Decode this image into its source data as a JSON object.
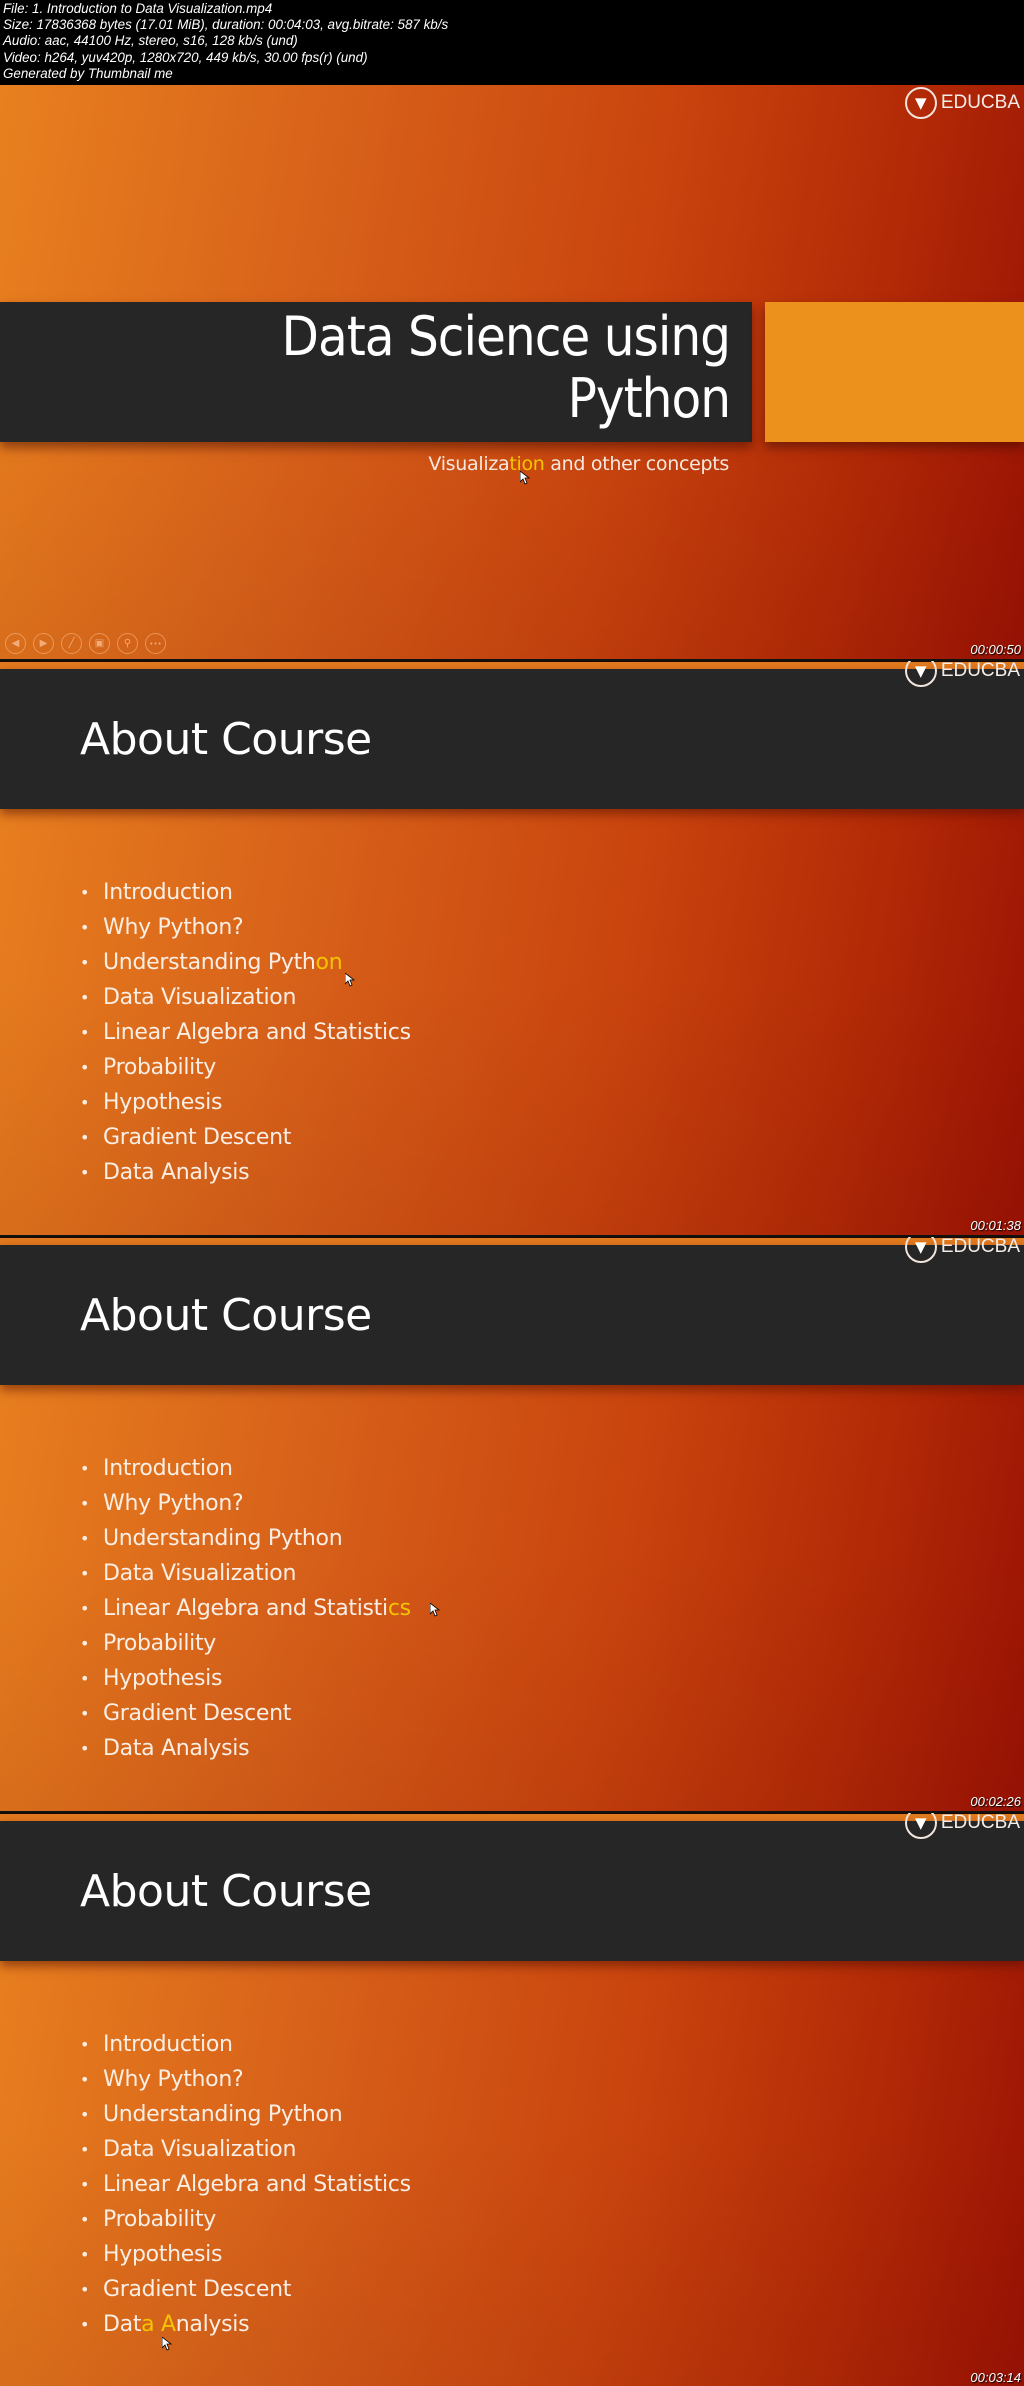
{
  "file_info": {
    "lines": [
      "File: 1. Introduction to Data Visualization.mp4",
      "Size: 17836368 bytes (17.01 MiB), duration: 00:04:03, avg.bitrate: 587 kb/s",
      "Audio: aac, 44100 Hz, stereo, s16, 128 kb/s (und)",
      "Video: h264, yuv420p, 1280x720, 449 kb/s, 30.00 fps(r) (und)",
      "Generated by Thumbnail me"
    ]
  },
  "brand": {
    "logo_text": "EDUCBA",
    "icon": "educba-book-cap-icon"
  },
  "colors": {
    "background_gradient_start": "#e8801f",
    "background_gradient_end": "#9a1204",
    "dark_band": "#262626",
    "accent_box": "#ec921c",
    "highlight": "#f3c400"
  },
  "slides": [
    {
      "type": "title",
      "title_line1": "Data Science using",
      "title_line2": "Python",
      "subtitle_pre": "Visualiza",
      "subtitle_hl": "tion",
      "subtitle_post": " and other concepts",
      "controls": [
        {
          "icon": "previous-icon",
          "glyph": "◀"
        },
        {
          "icon": "next-icon",
          "glyph": "▶"
        },
        {
          "icon": "pen-icon",
          "glyph": "╱"
        },
        {
          "icon": "slides-grid-icon",
          "glyph": "▣"
        },
        {
          "icon": "zoom-icon",
          "glyph": "⚲"
        },
        {
          "icon": "more-icon",
          "glyph": "•••"
        }
      ],
      "timestamp": "00:00:50"
    },
    {
      "type": "content",
      "title": "About Course",
      "items": [
        "Introduction",
        "Why Python?",
        "Understanding Pyth",
        "Data Visualization",
        "Linear Algebra and Statistics",
        "Probability",
        "Hypothesis",
        "Gradient Descent",
        "Data Analysis"
      ],
      "highlight_item": 2,
      "highlight_suffix": "on",
      "timestamp": "00:01:38"
    },
    {
      "type": "content",
      "title": "About Course",
      "items": [
        "Introduction",
        "Why Python?",
        "Understanding Python",
        "Data Visualization",
        "Linear Algebra and Statisti",
        "Probability",
        "Hypothesis",
        "Gradient Descent",
        "Data Analysis"
      ],
      "highlight_item": 4,
      "highlight_suffix": "cs",
      "timestamp": "00:02:26"
    },
    {
      "type": "content",
      "title": "About Course",
      "items": [
        "Introduction",
        "Why Python?",
        "Understanding Python",
        "Data Visualization",
        "Linear Algebra and Statistics",
        "Probability",
        "Hypothesis",
        "Gradient Descent",
        "Dat"
      ],
      "highlight_item": 8,
      "highlight_suffix": "a A",
      "highlight_rest": "nalysis",
      "timestamp": "00:03:14"
    }
  ]
}
